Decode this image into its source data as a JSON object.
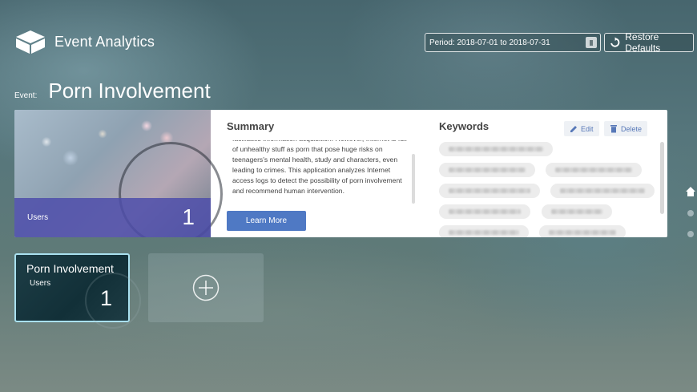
{
  "header": {
    "app_title": "Event Analytics",
    "logo_icon": "cube-box-icon"
  },
  "period": {
    "text": "Period: 2018-07-01 to 2018-07-31",
    "icon": "calendar-icon"
  },
  "restore": {
    "label": "Restore Defaults",
    "icon": "refresh-icon"
  },
  "event": {
    "label": "Event:",
    "title": "Porn Involvement"
  },
  "card": {
    "image": {
      "label": "Users",
      "count": "1"
    },
    "summary": {
      "title": "Summary",
      "text": "facilitates information acquisition. However, Internet is full of unhealthy stuff as porn that pose huge risks on teenagers's mental health, study and characters, even leading to crimes. This application analyzes Internet access logs to detect the possibility of porn involvement and recommend human intervention.",
      "button": "Learn More"
    },
    "keywords": {
      "title": "Keywords",
      "edit": "Edit",
      "delete": "Delete",
      "chips": [
        "",
        "",
        "",
        "",
        "",
        "",
        "",
        "",
        ""
      ]
    }
  },
  "side_nav": {
    "home_icon": "home-icon"
  },
  "tiles": [
    {
      "title": "Porn Involvement",
      "label": "Users",
      "count": "1"
    }
  ],
  "add_tile": {
    "icon": "plus-circle-icon"
  },
  "colors": {
    "accent": "#4f79c4",
    "band": "#4e4eaa",
    "tile_border": "#a9e0ef"
  }
}
